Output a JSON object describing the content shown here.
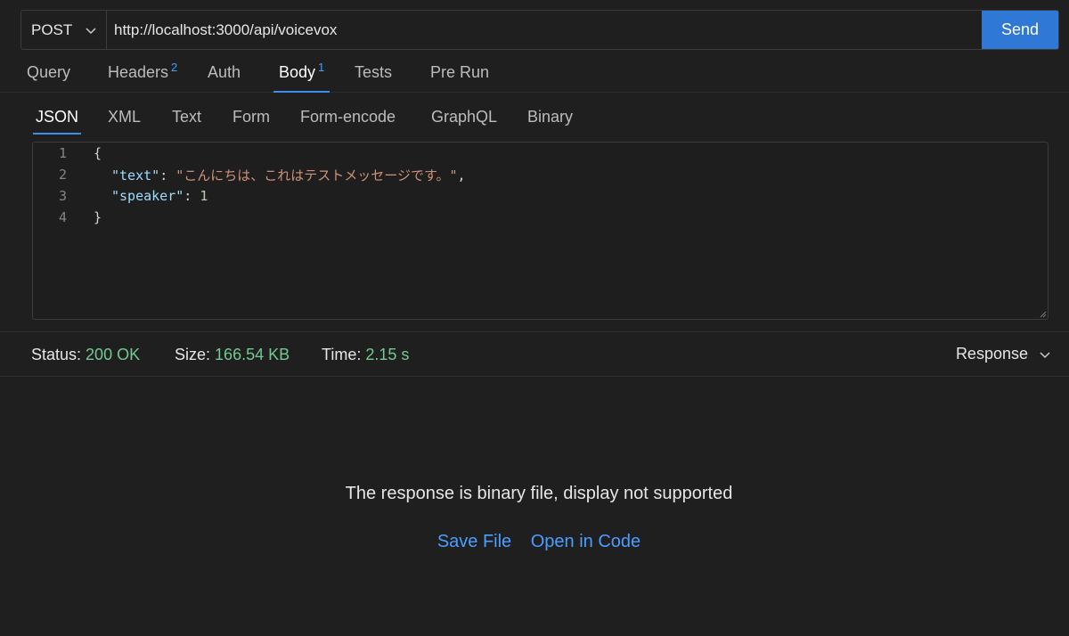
{
  "request": {
    "method": "POST",
    "url": "http://localhost:3000/api/voicevox",
    "send_label": "Send"
  },
  "tabs": [
    {
      "label": "Query",
      "badge": ""
    },
    {
      "label": "Headers",
      "badge": "2"
    },
    {
      "label": "Auth",
      "badge": ""
    },
    {
      "label": "Body",
      "badge": "1",
      "active": true
    },
    {
      "label": "Tests",
      "badge": ""
    },
    {
      "label": "Pre Run",
      "badge": ""
    }
  ],
  "body_tabs": [
    {
      "label": "JSON",
      "active": true
    },
    {
      "label": "XML"
    },
    {
      "label": "Text"
    },
    {
      "label": "Form"
    },
    {
      "label": "Form-encode"
    },
    {
      "label": "GraphQL"
    },
    {
      "label": "Binary"
    }
  ],
  "editor": {
    "line_numbers": [
      "1",
      "2",
      "3",
      "4"
    ],
    "open_brace": "{",
    "key_text": "\"text\"",
    "value_text": "\"こんにちは、これはテストメッセージです。\"",
    "key_speaker": "\"speaker\"",
    "value_speaker": "1",
    "close_brace": "}"
  },
  "status": {
    "status_label": "Status:",
    "status_value": "200 OK",
    "size_label": "Size:",
    "size_value": "166.54 KB",
    "time_label": "Time:",
    "time_value": "2.15 s",
    "response_select": "Response"
  },
  "response": {
    "message": "The response is binary file, display not supported",
    "save_file": "Save File",
    "open_in_code": "Open in Code"
  },
  "colors": {
    "accent": "#2f78d6",
    "status_ok": "#73c991",
    "link": "#4a9eff"
  }
}
